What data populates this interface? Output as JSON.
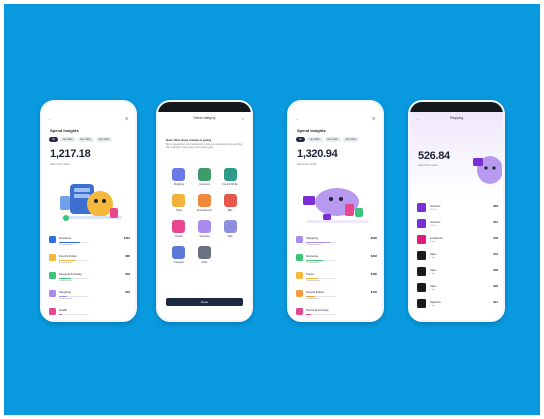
{
  "colors": {
    "background": "#0999df",
    "navy": "#1c2333",
    "accent_blue": "#2f6fe0",
    "purple": "#a98bee",
    "green": "#3ec37a",
    "orange": "#f59a3a",
    "pink": "#e8478f"
  },
  "phone1": {
    "title": "Spend Insights",
    "chips": [
      "All",
      "Jan 2022",
      "Dec 2021",
      "Nov 2021",
      "Oct 2021"
    ],
    "amount": "1,217.18",
    "sub": "Spent this month",
    "rows": [
      {
        "label": "Groceries",
        "sub": "12 transactions",
        "amount": "$113",
        "color": "#2f6fe0",
        "fill": 0.7
      },
      {
        "label": "Food & Drinks",
        "sub": "8 transactions",
        "amount": "$85",
        "color": "#f5b83a",
        "fill": 0.55
      },
      {
        "label": "Personal & Family",
        "sub": "4 transactions",
        "amount": "$56",
        "color": "#3ec37a",
        "fill": 0.4
      },
      {
        "label": "Shopping",
        "sub": "3 transactions",
        "amount": "$29",
        "color": "#a98bee",
        "fill": 0.25
      },
      {
        "label": "Health",
        "sub": "",
        "amount": "",
        "color": "#e8478f",
        "fill": 0.1
      }
    ]
  },
  "phone2": {
    "title": "Select category",
    "intro": "How often does money is going",
    "intro_sub": "We've categorised your transactions to help you understand your spending. Tap a category to see where your money goes.",
    "categories": [
      {
        "label": "Shopping",
        "color": "#6b7ae8"
      },
      {
        "label": "Groceries",
        "color": "#3e9c6a"
      },
      {
        "label": "Food & Drinks",
        "color": "#2f9a88"
      },
      {
        "label": "Travel",
        "color": "#f2b13a"
      },
      {
        "label": "Entertainment",
        "color": "#f08a3a"
      },
      {
        "label": "Bills",
        "color": "#e4574a"
      },
      {
        "label": "Health",
        "color": "#e8478f"
      },
      {
        "label": "Shopping",
        "color": "#a98bee"
      },
      {
        "label": "Gifts",
        "color": "#8f8fe0"
      },
      {
        "label": "Transport",
        "color": "#5a7ad6"
      },
      {
        "label": "Other",
        "color": "#6a7182"
      }
    ],
    "button": "Done"
  },
  "phone3": {
    "title": "Spend Insights",
    "chips": [
      "All",
      "Jan 2022",
      "Dec 2021",
      "Nov 2021",
      "Oct 2021"
    ],
    "amount": "1,320.94",
    "sub": "Spent this month",
    "rows": [
      {
        "label": "Shopping",
        "sub": "14 transactions",
        "amount": "$526",
        "color": "#a98bee",
        "fill": 0.8
      },
      {
        "label": "Groceries",
        "sub": "9 transactions",
        "amount": "$302",
        "color": "#3ec37a",
        "fill": 0.55
      },
      {
        "label": "Travel",
        "sub": "5 transactions",
        "amount": "$190",
        "color": "#f5b83a",
        "fill": 0.4
      },
      {
        "label": "Food & Drinks",
        "sub": "6 transactions",
        "amount": "$140",
        "color": "#f59a3a",
        "fill": 0.3
      },
      {
        "label": "Personal & Family",
        "sub": "",
        "amount": "",
        "color": "#e8478f",
        "fill": 0.15
      }
    ]
  },
  "phone4": {
    "title": "Shopping",
    "amount": "526.84",
    "sub": "Spent this month",
    "merchants": [
      {
        "name": "Amazon",
        "sub": "12 Jan",
        "amount": "$69",
        "color": "#7a2fd6"
      },
      {
        "name": "Amazon",
        "sub": "10 Jan",
        "amount": "$54",
        "color": "#7a2fd6"
      },
      {
        "name": "Lululemon",
        "sub": "8 Jan",
        "amount": "$48",
        "color": "#e01a7a"
      },
      {
        "name": "Zara",
        "sub": "6 Jan",
        "amount": "$42",
        "color": "#1a1a1a"
      },
      {
        "name": "Zara",
        "sub": "4 Jan",
        "amount": "$38",
        "color": "#1a1a1a"
      },
      {
        "name": "Zara",
        "sub": "2 Jan",
        "amount": "$29",
        "color": "#1a1a1a"
      },
      {
        "name": "Sephora",
        "sub": "1 Jan",
        "amount": "$21",
        "color": "#1a1a1a"
      }
    ]
  }
}
